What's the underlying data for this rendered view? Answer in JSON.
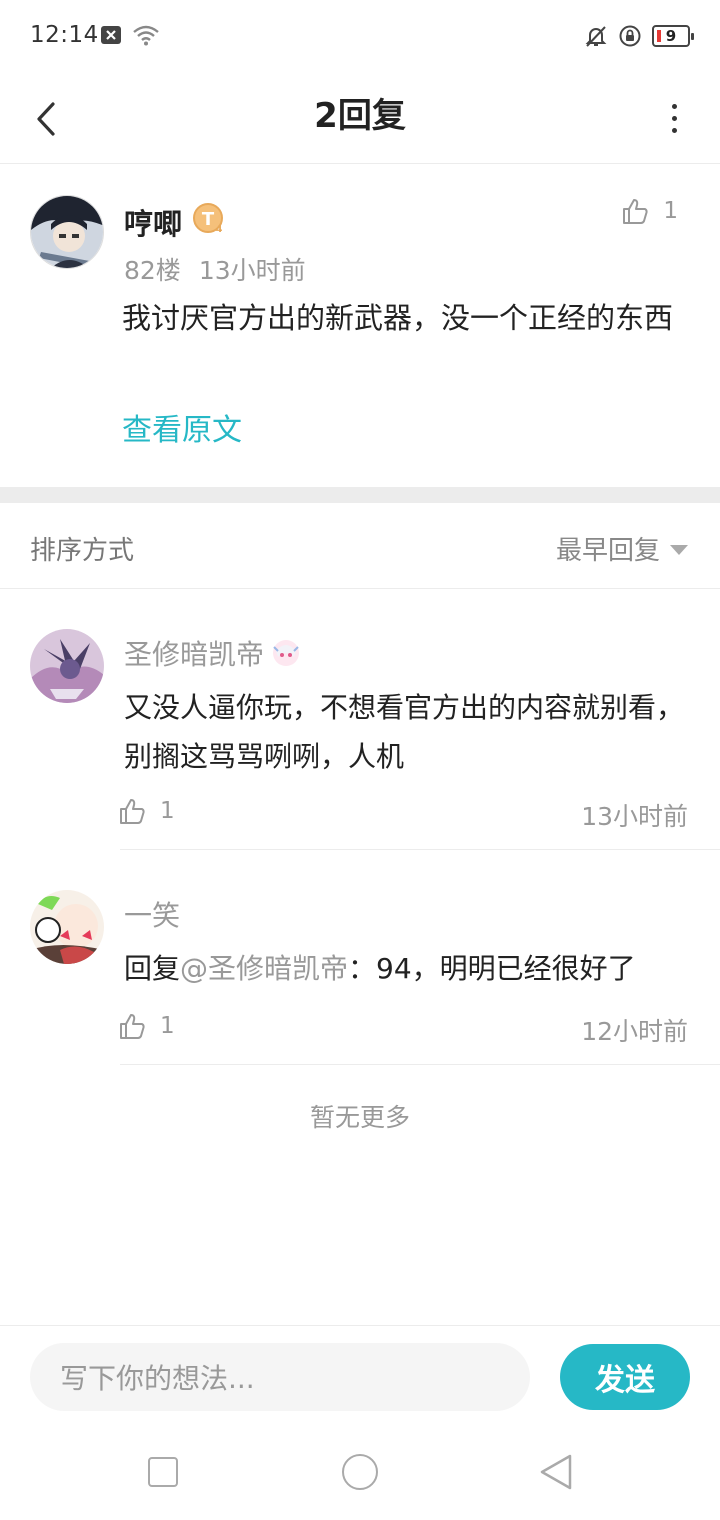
{
  "status_bar": {
    "time": "12:14",
    "battery_level": "9",
    "icons": [
      "close-box-icon",
      "wifi-icon",
      "bell-off-icon",
      "rotation-lock-icon",
      "battery-icon"
    ]
  },
  "header": {
    "title": "2回复",
    "back_icon": "chevron-left-icon",
    "more_icon": "more-vertical-icon"
  },
  "original_post": {
    "author": "哼唧",
    "badge_icon": "title-badge-icon",
    "floor": "82楼",
    "time": "13小时前",
    "likes": "1",
    "content": "我讨厌官方出的新武器，没一个正经的东西",
    "view_original_label": "查看原文"
  },
  "sort": {
    "label": "排序方式",
    "selected": "最早回复"
  },
  "replies": [
    {
      "author": "圣修暗凯帝",
      "content": "又没人逼你玩，不想看官方出的内容就别看，别搁这骂骂咧咧，人机",
      "likes": "1",
      "time": "13小时前"
    },
    {
      "author": "一笑",
      "reply_prefix": "回复",
      "mention": "@圣修暗凯帝",
      "content": "：94，明明已经很好了",
      "likes": "1",
      "time": "12小时前"
    }
  ],
  "footer_text": "暂无更多",
  "input": {
    "placeholder": "写下你的想法...",
    "send_label": "发送"
  },
  "colors": {
    "accent": "#26b8c6",
    "meta_text": "#999999",
    "divider": "#ececec"
  }
}
